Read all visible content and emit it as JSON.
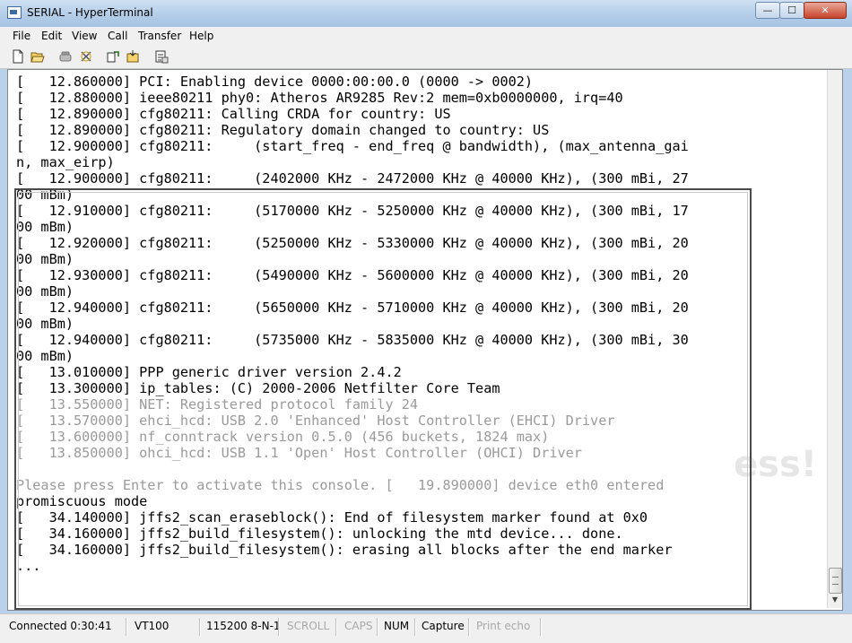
{
  "window": {
    "title": "SERIAL - HyperTerminal",
    "min_glyph": "—",
    "max_glyph": "☐",
    "close_glyph": "✕"
  },
  "menu": [
    "File",
    "Edit",
    "View",
    "Call",
    "Transfer",
    "Help"
  ],
  "toolbar": [
    "new-icon",
    "open-icon",
    "phone-icon",
    "disconnect-icon",
    "send-icon",
    "receive-icon",
    "properties-icon"
  ],
  "terminal": {
    "lines": [
      "[   12.860000] PCI: Enabling device 0000:00:00.0 (0000 -> 0002)",
      "[   12.880000] ieee80211 phy0: Atheros AR9285 Rev:2 mem=0xb0000000, irq=40",
      "[   12.890000] cfg80211: Calling CRDA for country: US",
      "[   12.890000] cfg80211: Regulatory domain changed to country: US",
      "[   12.900000] cfg80211:     (start_freq - end_freq @ bandwidth), (max_antenna_gai",
      "n, max_eirp)",
      "[   12.900000] cfg80211:     (2402000 KHz - 2472000 KHz @ 40000 KHz), (300 mBi, 27",
      "00 mBm)",
      "[   12.910000] cfg80211:     (5170000 KHz - 5250000 KHz @ 40000 KHz), (300 mBi, 17",
      "00 mBm)",
      "[   12.920000] cfg80211:     (5250000 KHz - 5330000 KHz @ 40000 KHz), (300 mBi, 20",
      "00 mBm)",
      "[   12.930000] cfg80211:     (5490000 KHz - 5600000 KHz @ 40000 KHz), (300 mBi, 20",
      "00 mBm)",
      "[   12.940000] cfg80211:     (5650000 KHz - 5710000 KHz @ 40000 KHz), (300 mBi, 20",
      "00 mBm)",
      "[   12.940000] cfg80211:     (5735000 KHz - 5835000 KHz @ 40000 KHz), (300 mBi, 30",
      "00 mBm)",
      "[   13.010000] PPP generic driver version 2.4.2",
      "[   13.300000] ip_tables: (C) 2000-2006 Netfilter Core Team",
      "[   13.550000] NET: Registered protocol family 24",
      "[   13.570000] ehci_hcd: USB 2.0 'Enhanced' Host Controller (EHCI) Driver",
      "[   13.600000] nf_conntrack version 0.5.0 (456 buckets, 1824 max)",
      "[   13.850000] ohci_hcd: USB 1.1 'Open' Host Controller (OHCI) Driver",
      "",
      "Please press Enter to activate this console. [   19.890000] device eth0 entered",
      "promiscuous mode",
      "[   34.140000] jffs2_scan_eraseblock(): End of filesystem marker found at 0x0",
      "[   34.160000] jffs2_build_filesystem(): unlocking the mtd device... done.",
      "[   34.160000] jffs2_build_filesystem(): erasing all blocks after the end marker",
      "..."
    ],
    "dim_lines": [
      20,
      21,
      22,
      23,
      25
    ],
    "watermark": "ess!"
  },
  "status": {
    "connected": "Connected 0:30:41",
    "emulation": "VT100",
    "settings": "115200 8-N-1",
    "scroll": "SCROLL",
    "caps": "CAPS",
    "num": "NUM",
    "capture": "Capture",
    "print_echo": "Print echo"
  },
  "colors": {
    "titlebar": "#b6cfe9",
    "chrome": "#f0f0f0",
    "terminal_bg": "#ffffff",
    "text": "#000000",
    "dim_text": "#9a9a9a"
  }
}
